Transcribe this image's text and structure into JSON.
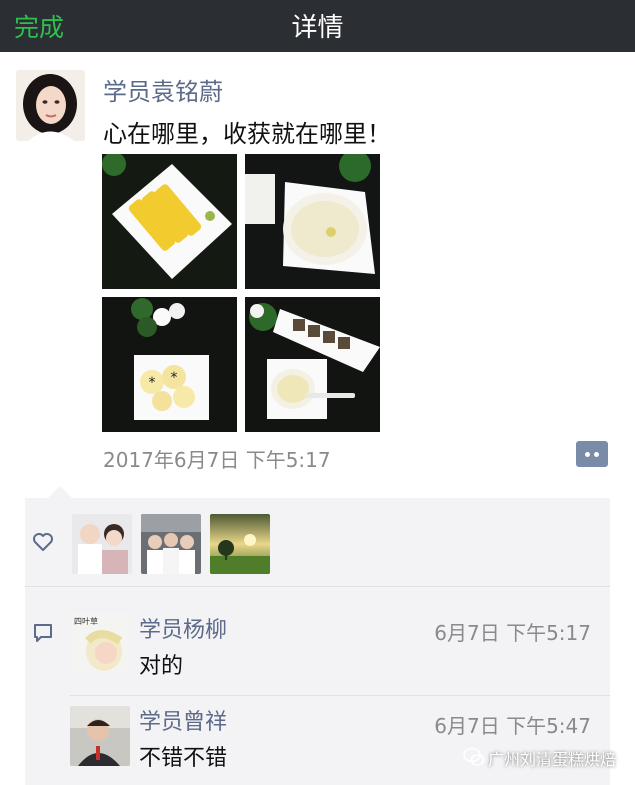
{
  "header": {
    "done_label": "完成",
    "title": "详情"
  },
  "post": {
    "author": "学员袁铭蔚",
    "text": "心在哪里，收获就在哪里！",
    "timestamp": "2017年6月7日 下午5:17",
    "photos": [
      {
        "icon": "food-photo-mango"
      },
      {
        "icon": "food-photo-bowl"
      },
      {
        "icon": "food-photo-cookies"
      },
      {
        "icon": "food-photo-cake"
      }
    ]
  },
  "likes": {
    "icon": "heart-icon",
    "avatars": [
      {
        "icon": "avatar-photo"
      },
      {
        "icon": "avatar-photo"
      },
      {
        "icon": "landscape-photo"
      }
    ]
  },
  "comments": [
    {
      "name": "学员杨柳",
      "time": "6月7日 下午5:17",
      "text": "对的"
    },
    {
      "name": "学员曾祥",
      "time": "6月7日 下午5:47",
      "text": "不错不错"
    }
  ],
  "watermark": "广州刘清蛋糕烘焙",
  "colors": {
    "header_bg": "#2b2e33",
    "accent_green": "#2fbf4f",
    "name_blue": "#5d6b8a",
    "panel_bg": "#f3f3f5"
  }
}
